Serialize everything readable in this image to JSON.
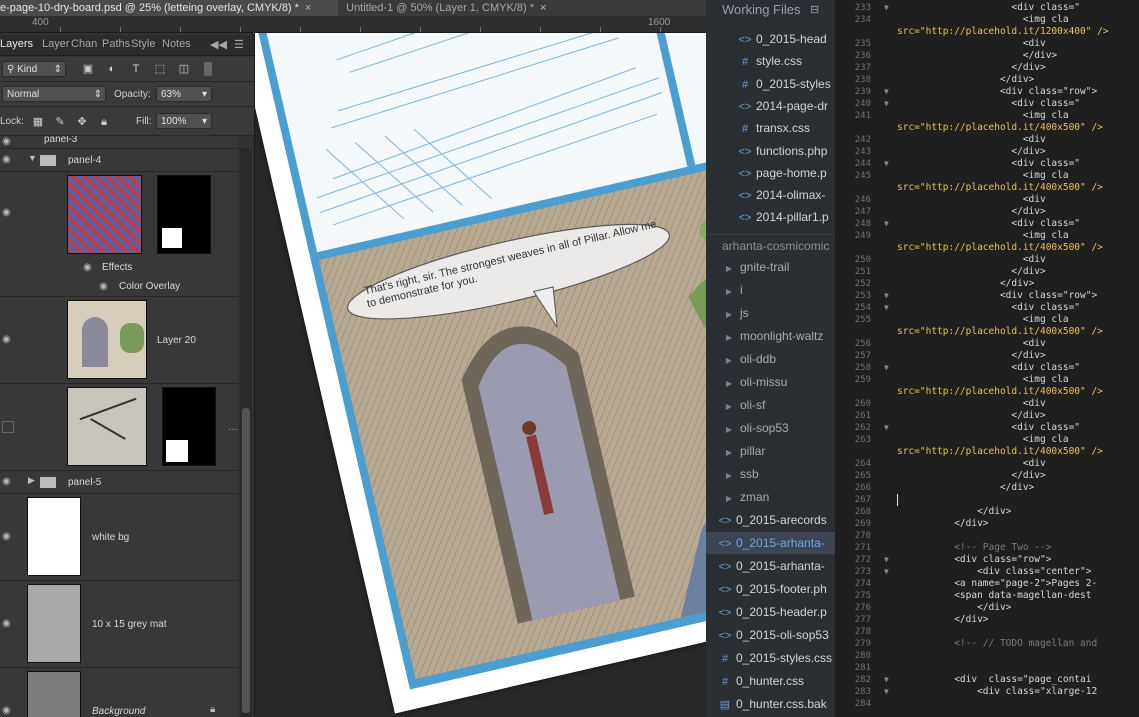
{
  "photoshop": {
    "tabs": [
      {
        "label": "e-page-10-dry-board.psd @ 25% (letteing overlay, CMYK/8) *",
        "close": "×"
      },
      {
        "label": "Untitled-1 @ 50% (Layer 1, CMYK/8) *",
        "close": "×"
      }
    ],
    "ruler": {
      "marks": [
        "400",
        "1600"
      ]
    },
    "layers_panel": {
      "tabs": [
        "Layers",
        "Layer",
        "Chan",
        "Paths",
        "Style",
        "Notes"
      ],
      "filter_kind": "Kind",
      "blend_mode": "Normal",
      "opacity_label": "Opacity:",
      "opacity_value": "63%",
      "lock_label": "Lock:",
      "fill_label": "Fill:",
      "fill_value": "100%",
      "layers": [
        {
          "name": "panel-3"
        },
        {
          "name": "panel-4"
        },
        {
          "name": "Effects"
        },
        {
          "name": "Color Overlay"
        },
        {
          "name": "Layer 20"
        },
        {
          "name": "panel-5"
        },
        {
          "name": "white bg"
        },
        {
          "name": "10 x 15 grey mat"
        },
        {
          "name": "Background"
        }
      ]
    },
    "speech_bubble": "That's right, sir. The strongest weaves in all of Pillar. Allow me to demonstrate for you."
  },
  "sidebar": {
    "working_files_title": "Working Files",
    "working_files": [
      {
        "name": "0_2015-head",
        "icon": "code-file-icon"
      },
      {
        "name": "style.css",
        "icon": "hash-icon"
      },
      {
        "name": "0_2015-styles",
        "icon": "hash-icon"
      },
      {
        "name": "2014-page-dr",
        "icon": "code-file-icon"
      },
      {
        "name": "transx.css",
        "icon": "hash-icon"
      },
      {
        "name": "functions.php",
        "icon": "code-file-icon"
      },
      {
        "name": "page-home.p",
        "icon": "code-file-icon"
      },
      {
        "name": "2014-olimax-",
        "icon": "code-file-icon"
      },
      {
        "name": "2014-pillar1.p",
        "icon": "code-file-icon"
      }
    ],
    "project_title": "arhanta-cosmicomic",
    "folders": [
      "gnite-trail",
      "i",
      "js",
      "moonlight-waltz",
      "oli-ddb",
      "oli-missu",
      "oli-sf",
      "oli-sop53",
      "pillar",
      "ssb",
      "zman"
    ],
    "files": [
      {
        "name": "0_2015-arecords",
        "icon": "code-file-icon",
        "active": false
      },
      {
        "name": "0_2015-arhanta-",
        "icon": "code-file-icon",
        "active": true
      },
      {
        "name": "0_2015-arhanta-",
        "icon": "code-file-icon",
        "active": false
      },
      {
        "name": "0_2015-footer.ph",
        "icon": "code-file-icon",
        "active": false
      },
      {
        "name": "0_2015-header.p",
        "icon": "code-file-icon",
        "active": false
      },
      {
        "name": "0_2015-oli-sop53",
        "icon": "code-file-icon",
        "active": false
      },
      {
        "name": "0_2015-styles.css",
        "icon": "hash-icon",
        "active": false
      },
      {
        "name": "0_hunter.css",
        "icon": "hash-icon",
        "active": false
      },
      {
        "name": "0_hunter.css.bak",
        "icon": "doc-file-icon",
        "active": false
      }
    ]
  },
  "editor": {
    "lines": [
      {
        "n": "233",
        "fold": "▼",
        "code": "                    <div class=\"",
        "kind": "tag"
      },
      {
        "n": "234",
        "fold": "",
        "code": "                      <img cla",
        "kind": "tag"
      },
      {
        "n": "",
        "fold": "",
        "code": "src=\"http://placehold.it/1200x400\" />",
        "kind": "str"
      },
      {
        "n": "235",
        "fold": "",
        "code": "                      <div",
        "kind": "tag"
      },
      {
        "n": "236",
        "fold": "",
        "code": "                      </div>",
        "kind": "tag"
      },
      {
        "n": "237",
        "fold": "",
        "code": "                    </div>",
        "kind": "tag"
      },
      {
        "n": "238",
        "fold": "",
        "code": "                  </div>",
        "kind": "tag"
      },
      {
        "n": "239",
        "fold": "▼",
        "code": "                  <div class=\"row\">",
        "kind": "tag"
      },
      {
        "n": "240",
        "fold": "▼",
        "code": "                    <div class=\"",
        "kind": "tag"
      },
      {
        "n": "241",
        "fold": "",
        "code": "                      <img cla",
        "kind": "tag"
      },
      {
        "n": "",
        "fold": "",
        "code": "src=\"http://placehold.it/400x500\" />",
        "kind": "str"
      },
      {
        "n": "242",
        "fold": "",
        "code": "                      <div",
        "kind": "tag"
      },
      {
        "n": "243",
        "fold": "",
        "code": "                    </div>",
        "kind": "tag"
      },
      {
        "n": "244",
        "fold": "▼",
        "code": "                    <div class=\"",
        "kind": "tag"
      },
      {
        "n": "245",
        "fold": "",
        "code": "                      <img cla",
        "kind": "tag"
      },
      {
        "n": "",
        "fold": "",
        "code": "src=\"http://placehold.it/400x500\" />",
        "kind": "str"
      },
      {
        "n": "246",
        "fold": "",
        "code": "                      <div",
        "kind": "tag"
      },
      {
        "n": "247",
        "fold": "",
        "code": "                    </div>",
        "kind": "tag"
      },
      {
        "n": "248",
        "fold": "▼",
        "code": "                    <div class=\"",
        "kind": "tag"
      },
      {
        "n": "249",
        "fold": "",
        "code": "                      <img cla",
        "kind": "tag"
      },
      {
        "n": "",
        "fold": "",
        "code": "src=\"http://placehold.it/400x500\" />",
        "kind": "str"
      },
      {
        "n": "250",
        "fold": "",
        "code": "                      <div",
        "kind": "tag"
      },
      {
        "n": "251",
        "fold": "",
        "code": "                    </div>",
        "kind": "tag"
      },
      {
        "n": "252",
        "fold": "",
        "code": "                  </div>",
        "kind": "tag"
      },
      {
        "n": "253",
        "fold": "▼",
        "code": "                  <div class=\"row\">",
        "kind": "tag"
      },
      {
        "n": "254",
        "fold": "▼",
        "code": "                    <div class=\"",
        "kind": "tag"
      },
      {
        "n": "255",
        "fold": "",
        "code": "                      <img cla",
        "kind": "tag"
      },
      {
        "n": "",
        "fold": "",
        "code": "src=\"http://placehold.it/400x500\" />",
        "kind": "str"
      },
      {
        "n": "256",
        "fold": "",
        "code": "                      <div",
        "kind": "tag"
      },
      {
        "n": "257",
        "fold": "",
        "code": "                    </div>",
        "kind": "tag"
      },
      {
        "n": "258",
        "fold": "▼",
        "code": "                    <div class=\"",
        "kind": "tag"
      },
      {
        "n": "259",
        "fold": "",
        "code": "                      <img cla",
        "kind": "tag"
      },
      {
        "n": "",
        "fold": "",
        "code": "src=\"http://placehold.it/400x500\" />",
        "kind": "str"
      },
      {
        "n": "260",
        "fold": "",
        "code": "                      <div",
        "kind": "tag"
      },
      {
        "n": "261",
        "fold": "",
        "code": "                    </div>",
        "kind": "tag"
      },
      {
        "n": "262",
        "fold": "▼",
        "code": "                    <div class=\"",
        "kind": "tag"
      },
      {
        "n": "263",
        "fold": "",
        "code": "                      <img cla",
        "kind": "tag"
      },
      {
        "n": "",
        "fold": "",
        "code": "src=\"http://placehold.it/400x500\" />",
        "kind": "str"
      },
      {
        "n": "264",
        "fold": "",
        "code": "                      <div",
        "kind": "tag"
      },
      {
        "n": "265",
        "fold": "",
        "code": "                    </div>",
        "kind": "tag"
      },
      {
        "n": "266",
        "fold": "",
        "code": "                  </div>",
        "kind": "tag"
      },
      {
        "n": "267",
        "fold": "",
        "code": "",
        "kind": "tag"
      },
      {
        "n": "268",
        "fold": "",
        "code": "              </div>",
        "kind": "tag"
      },
      {
        "n": "269",
        "fold": "",
        "code": "          </div>",
        "kind": "tag"
      },
      {
        "n": "270",
        "fold": "",
        "code": "",
        "kind": "tag"
      },
      {
        "n": "271",
        "fold": "",
        "code": "          <!-- Page Two -->",
        "kind": "comment"
      },
      {
        "n": "272",
        "fold": "▼",
        "code": "          <div class=\"row\">",
        "kind": "tag"
      },
      {
        "n": "273",
        "fold": "▼",
        "code": "              <div class=\"center\">",
        "kind": "tag"
      },
      {
        "n": "274",
        "fold": "",
        "code": "          <a name=\"page-2\">Pages 2-",
        "kind": "tag"
      },
      {
        "n": "275",
        "fold": "",
        "code": "          <span data-magellan-dest",
        "kind": "tag"
      },
      {
        "n": "276",
        "fold": "",
        "code": "              </div>",
        "kind": "tag"
      },
      {
        "n": "277",
        "fold": "",
        "code": "          </div>",
        "kind": "tag"
      },
      {
        "n": "278",
        "fold": "",
        "code": "",
        "kind": "tag"
      },
      {
        "n": "279",
        "fold": "",
        "code": "          <!-- // TODO magellan and",
        "kind": "comment"
      },
      {
        "n": "280",
        "fold": "",
        "code": "",
        "kind": "tag"
      },
      {
        "n": "281",
        "fold": "",
        "code": "",
        "kind": "tag"
      },
      {
        "n": "282",
        "fold": "▼",
        "code": "          <div  class=\"page_contai",
        "kind": "tag"
      },
      {
        "n": "283",
        "fold": "▼",
        "code": "              <div class=\"xlarge-12",
        "kind": "tag"
      },
      {
        "n": "284",
        "fold": "",
        "code": "",
        "kind": "tag"
      }
    ]
  }
}
